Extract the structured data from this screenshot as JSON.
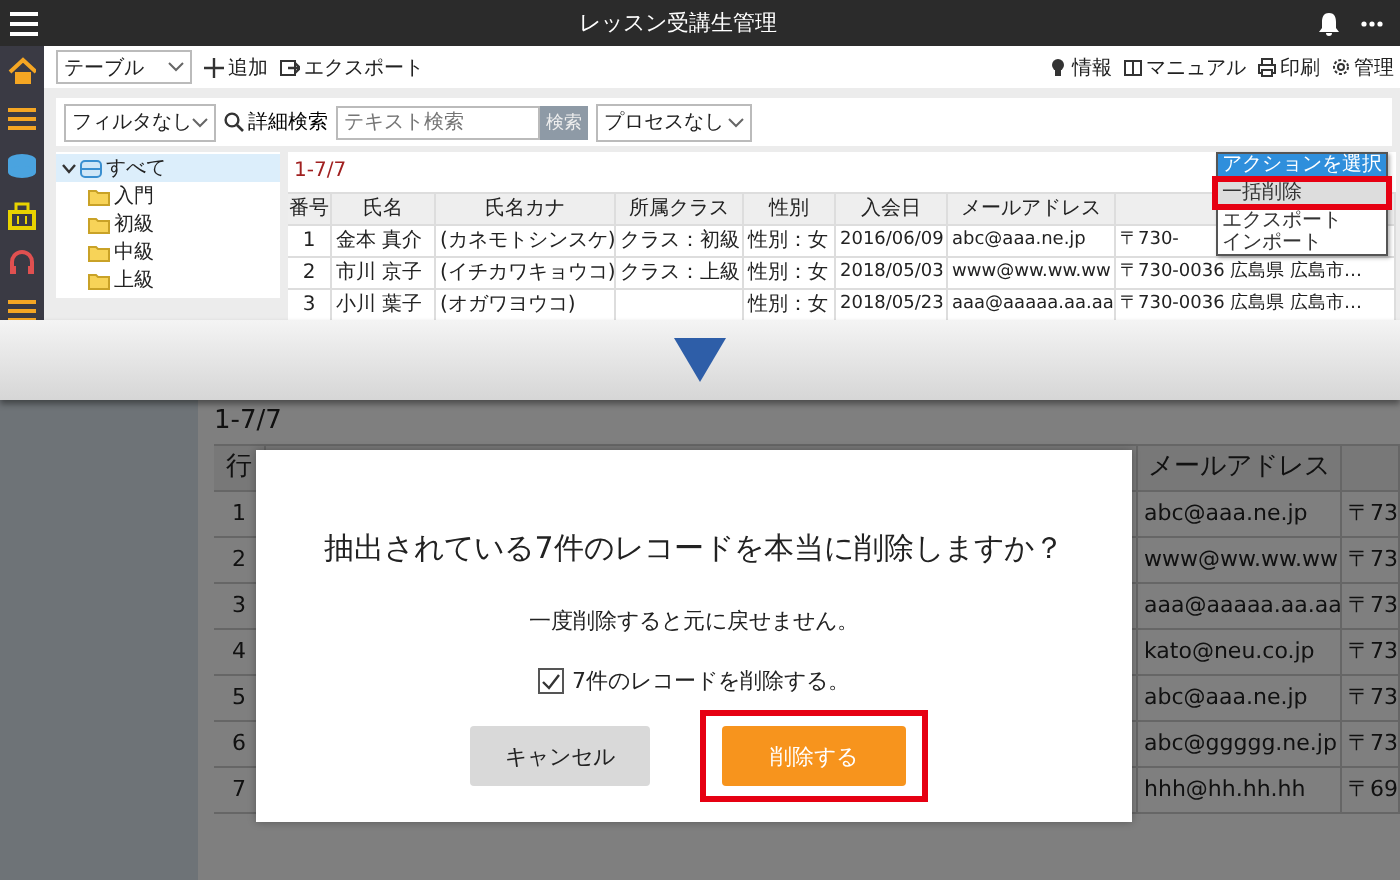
{
  "top_screen": {
    "app_bar": {
      "title": "レッスン受講生管理"
    },
    "toolbar": {
      "view_select": "テーブル",
      "actions": [
        {
          "kind": "add",
          "label": "追加"
        },
        {
          "kind": "export",
          "label": "エクスポート"
        }
      ],
      "links": [
        {
          "kind": "info",
          "label": "情報"
        },
        {
          "kind": "manual",
          "label": "マニュアル"
        },
        {
          "kind": "print",
          "label": "印刷"
        },
        {
          "kind": "admin",
          "label": "管理"
        }
      ]
    },
    "filter_bar": {
      "filter_select": "フィルタなし",
      "advanced_search": "詳細検索",
      "search": {
        "placeholder": "テキスト検索",
        "button": "検索"
      },
      "process_select": "プロセスなし"
    },
    "tree": [
      {
        "label": "すべて",
        "expanded": true,
        "selected": true,
        "children": [
          {
            "label": "入門",
            "selected": false
          },
          {
            "label": "初級",
            "selected": false
          },
          {
            "label": "中級",
            "selected": false
          },
          {
            "label": "上級",
            "selected": false
          }
        ]
      }
    ],
    "record_count": "1-7/7",
    "action_menu": [
      {
        "label": "アクションを選択",
        "selected": true,
        "highlighted": false
      },
      {
        "label": "一括削除",
        "selected": false,
        "highlighted": true
      },
      {
        "label": "エクスポート",
        "selected": false,
        "highlighted": false
      },
      {
        "label": "インポート",
        "selected": false,
        "highlighted": false
      }
    ],
    "table": {
      "columns": [
        "番号",
        "氏名",
        "氏名カナ",
        "所属クラス",
        "性別",
        "入会日",
        "メールアドレス"
      ],
      "rows": [
        [
          "1",
          "金本 真介",
          "(カネモトシンスケ)",
          "クラス：初級",
          "性別：女",
          "2016/06/09",
          "abc@aaa.ne.jp",
          "〒730-"
        ],
        [
          "2",
          "市川 京子",
          "(イチカワキョウコ)",
          "クラス：上級",
          "性別：女",
          "2018/05/03",
          "www@ww.ww.ww",
          "〒730-0036 広島県 広島市…"
        ],
        [
          "3",
          "小川 葉子",
          "(オガワヨウコ)",
          "",
          "性別：女",
          "2018/05/23",
          "aaa@aaaaa.aa.aa",
          "〒730-0036 広島県 広島市…"
        ]
      ]
    }
  },
  "bottom_screen": {
    "record_count": "1-7/7",
    "table": {
      "columns": [
        "行",
        "メールアドレス"
      ],
      "rows": [
        {
          "number": "1",
          "email": "abc@aaa.ne.jp",
          "column_3": "〒73"
        },
        {
          "number": "2",
          "email": "www@ww.ww.ww",
          "column_3": "〒73"
        },
        {
          "number": "3",
          "email": "aaa@aaaaa.aa.aa",
          "column_3": "〒73"
        },
        {
          "number": "4",
          "email": "kato@neu.co.jp",
          "column_3": "〒73"
        },
        {
          "number": "5",
          "email": "abc@aaa.ne.jp",
          "column_3": "〒73"
        },
        {
          "number": "6",
          "email": "abc@ggggg.ne.jp",
          "column_3": "〒73"
        },
        {
          "number": "7",
          "email": "hhh@hh.hh.hh",
          "column_3": "〒69"
        }
      ]
    },
    "dialog": {
      "question": "抽出されている7件のレコードを本当に削除しますか？",
      "note": "一度削除すると元に戻せません。",
      "confirm": {
        "label": "7件のレコードを削除する。",
        "checked": true
      },
      "buttons": [
        {
          "kind": "secondary",
          "label": "キャンセル",
          "highlighted": false
        },
        {
          "kind": "primary",
          "label": "削除する",
          "highlighted": true
        }
      ]
    }
  }
}
